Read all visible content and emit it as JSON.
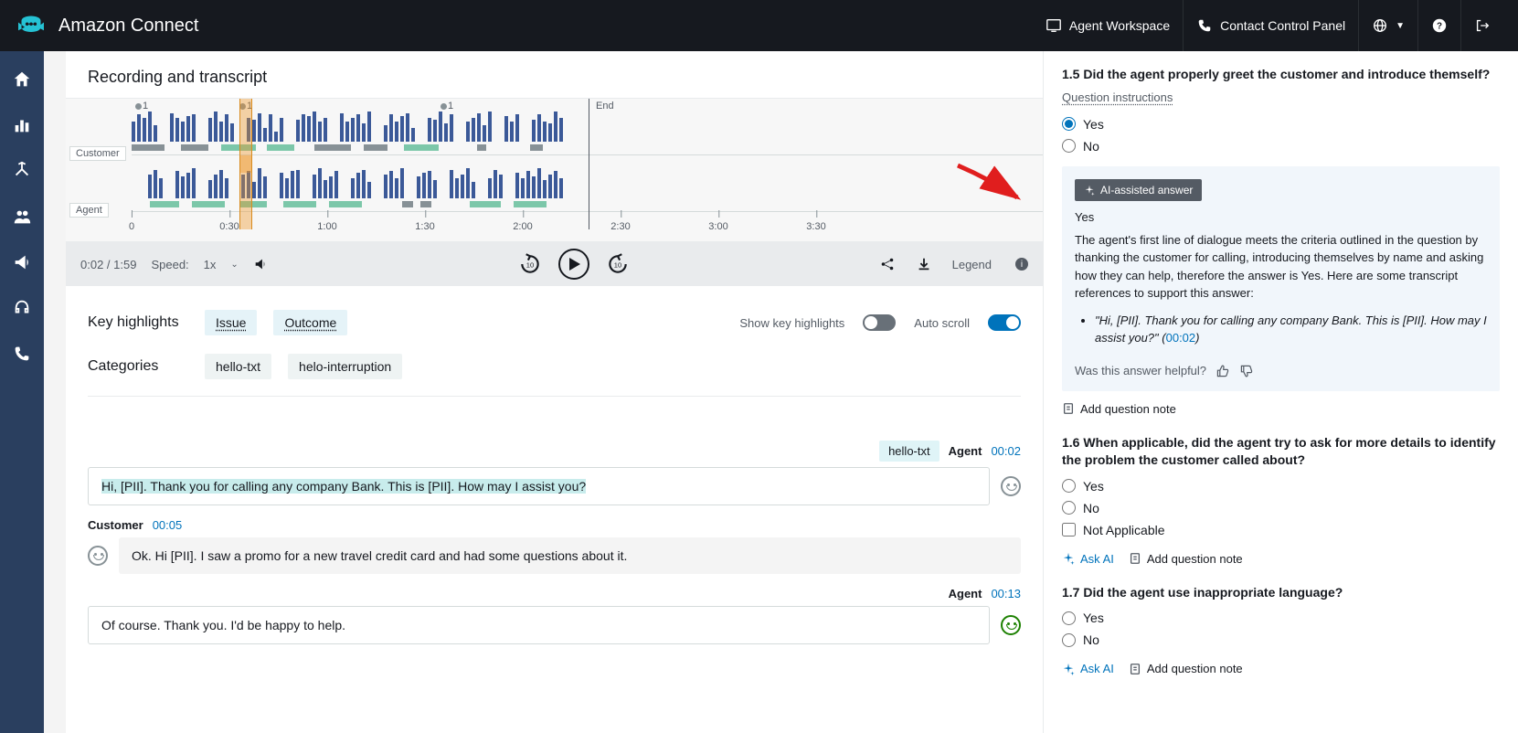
{
  "header": {
    "product": "Amazon Connect",
    "agentWorkspace": "Agent Workspace",
    "ccp": "Contact Control Panel"
  },
  "recording": {
    "title": "Recording and transcript",
    "customerLabel": "Customer",
    "agentLabel": "Agent",
    "endLabel": "End",
    "marker": "1",
    "ticks": [
      "0",
      "0:30",
      "1:00",
      "1:30",
      "2:00",
      "2:30",
      "3:00",
      "3:30"
    ]
  },
  "player": {
    "time": "0:02 / 1:59",
    "speedLabel": "Speed:",
    "speedValue": "1x",
    "legend": "Legend"
  },
  "highlights": {
    "title": "Key highlights",
    "issue": "Issue",
    "outcome": "Outcome",
    "categoriesLabel": "Categories",
    "cat1": "hello-txt",
    "cat2": "helo-interruption",
    "showKey": "Show key highlights",
    "autoScroll": "Auto scroll"
  },
  "transcript": {
    "msg1": {
      "tag": "hello-txt",
      "who": "Agent",
      "ts": "00:02",
      "text": "Hi, [PII]. Thank you for calling any company Bank. This is [PII]. How may I assist you?"
    },
    "msg2": {
      "who": "Customer",
      "ts": "00:05",
      "text": "Ok. Hi [PII]. I saw a promo for a new travel credit card and had some questions about it."
    },
    "msg3": {
      "who": "Agent",
      "ts": "00:13",
      "text": "Of course. Thank you. I'd be happy to help."
    }
  },
  "eval": {
    "q15": {
      "title": "1.5 Did the agent properly greet the customer and introduce themself?",
      "instr": "Question instructions",
      "yes": "Yes",
      "no": "No",
      "aiBadge": "AI-assisted answer",
      "aiAnswer": "Yes",
      "aiExpl": "The agent's first line of dialogue meets the criteria outlined in the question by thanking the customer for calling, introducing themselves by name and asking how they can help, therefore the answer is Yes. Here are some transcript references to support this answer:",
      "aiQuote": "\"Hi, [PII]. Thank you for calling any company Bank. This is [PII]. How may I assist you?\"",
      "aiQuoteTs": "00:02",
      "feedback": "Was this answer helpful?",
      "addNote": "Add question note"
    },
    "q16": {
      "title": "1.6 When applicable, did the agent try to ask for more details to identify the problem the customer called about?",
      "yes": "Yes",
      "no": "No",
      "na": "Not Applicable",
      "askAI": "Ask AI",
      "addNote": "Add question note"
    },
    "q17": {
      "title": "1.7 Did the agent use inappropriate language?",
      "yes": "Yes",
      "no": "No",
      "askAI": "Ask AI",
      "addNote": "Add question note"
    }
  }
}
